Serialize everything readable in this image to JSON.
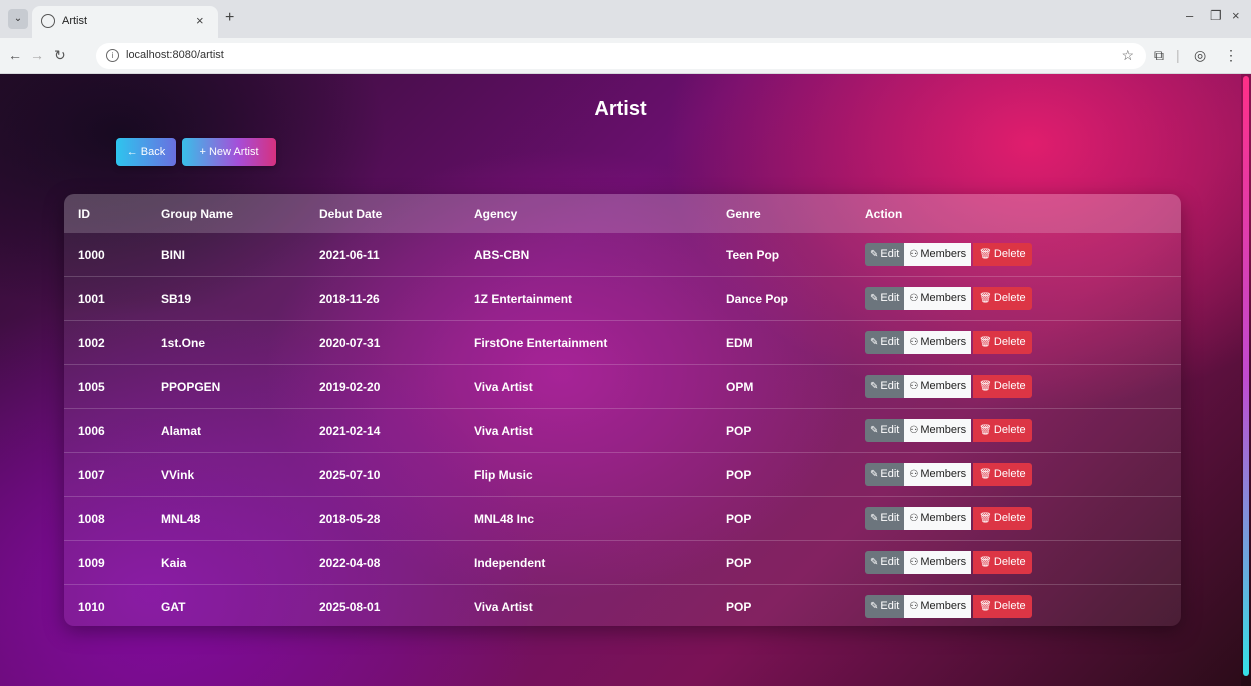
{
  "browser": {
    "tab_title": "Artist",
    "url": "localhost:8080/artist"
  },
  "page": {
    "title": "Artist",
    "back_label": "Back",
    "new_label": "New Artist"
  },
  "table": {
    "headers": [
      "ID",
      "Group Name",
      "Debut Date",
      "Agency",
      "Genre",
      "Action"
    ],
    "rows": [
      {
        "id": "1000",
        "name": "BINI",
        "debut": "2021-06-11",
        "agency": "ABS-CBN",
        "genre": "Teen Pop"
      },
      {
        "id": "1001",
        "name": "SB19",
        "debut": "2018-11-26",
        "agency": "1Z Entertainment",
        "genre": "Dance Pop"
      },
      {
        "id": "1002",
        "name": "1st.One",
        "debut": "2020-07-31",
        "agency": "FirstOne Entertainment",
        "genre": "EDM"
      },
      {
        "id": "1005",
        "name": "PPOPGEN",
        "debut": "2019-02-20",
        "agency": "Viva Artist",
        "genre": "OPM"
      },
      {
        "id": "1006",
        "name": "Alamat",
        "debut": "2021-02-14",
        "agency": "Viva Artist",
        "genre": "POP"
      },
      {
        "id": "1007",
        "name": "VVink",
        "debut": "2025-07-10",
        "agency": "Flip Music",
        "genre": "POP"
      },
      {
        "id": "1008",
        "name": "MNL48",
        "debut": "2018-05-28",
        "agency": "MNL48 Inc",
        "genre": "POP"
      },
      {
        "id": "1009",
        "name": "Kaia",
        "debut": "2022-04-08",
        "agency": "Independent",
        "genre": "POP"
      },
      {
        "id": "1010",
        "name": "GAT",
        "debut": "2025-08-01",
        "agency": "Viva Artist",
        "genre": "POP"
      }
    ],
    "actions": {
      "edit": "Edit",
      "members": "Members",
      "delete": "Delete"
    }
  }
}
